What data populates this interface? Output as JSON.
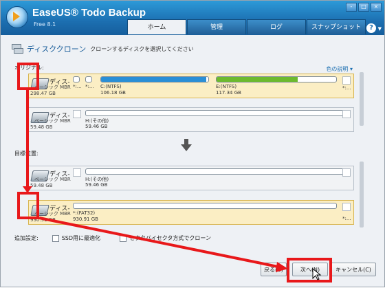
{
  "app": {
    "title": "EaseUS® Todo Backup",
    "edition": "Free 8.1"
  },
  "window_buttons": [
    "-",
    "□",
    "×"
  ],
  "tabs": [
    {
      "label": "ホーム",
      "active": true
    },
    {
      "label": "管理"
    },
    {
      "label": "ログ"
    },
    {
      "label": "スナップショット"
    }
  ],
  "help_label": "?",
  "page": {
    "title": "ディスククローン",
    "subtitle": "クローンするディスクを選択してください"
  },
  "source_label": "オリジナル:",
  "target_label": "目標位置:",
  "legend_link": "色の説明 ▾",
  "source_disks": [
    {
      "name": "ディス-",
      "type": "ベーシック MBR",
      "size": "298.47 GB",
      "selected": true,
      "partitions": [
        {
          "label": "*:...",
          "size": "",
          "fill": 0.0,
          "color": "#2a8fd6"
        },
        {
          "label": "*:...",
          "size": "",
          "fill": 0.0,
          "color": "#2a8fd6"
        },
        {
          "label": "C:(NTFS)",
          "size": "106.18 GB",
          "fill": 0.98,
          "color": "#2a8fd6"
        },
        {
          "label": "E:(NTFS)",
          "size": "117.34 GB",
          "fill": 0.68,
          "color": "#6cba2e"
        }
      ],
      "trailing": "*:..."
    },
    {
      "name": "ディス-",
      "type": "ベーシック MBR",
      "size": "59.48 GB",
      "selected": false,
      "partitions": [
        {
          "label": "H:(その他)",
          "size": "59.46 GB",
          "fill": 0.0,
          "color": "#2a8fd6"
        }
      ],
      "trailing": ""
    }
  ],
  "target_disks": [
    {
      "name": "ディス-",
      "type": "ベーシック MBR",
      "size": "59.48 GB",
      "selected": false,
      "partitions": [
        {
          "label": "H:(その他)",
          "size": "59.46 GB",
          "fill": 0.0,
          "color": "#2a8fd6"
        }
      ],
      "trailing": ""
    },
    {
      "name": "ディス-",
      "type": "ベーシック MBR",
      "size": "930.91 GB",
      "selected": true,
      "partitions": [
        {
          "label": "*:(FAT32)",
          "size": "930.91 GB",
          "fill": 0.0,
          "color": "#2a8fd6"
        }
      ],
      "trailing": "*:..."
    }
  ],
  "options_label": "追加設定:",
  "options": [
    {
      "label": "SSD用に最適化",
      "checked": false
    },
    {
      "label": "セクタバイセクタ方式でクローン",
      "checked": false
    }
  ],
  "buttons": {
    "back": "戻る(B)",
    "next": "次へ(N)",
    "cancel": "キャンセル(C)"
  }
}
